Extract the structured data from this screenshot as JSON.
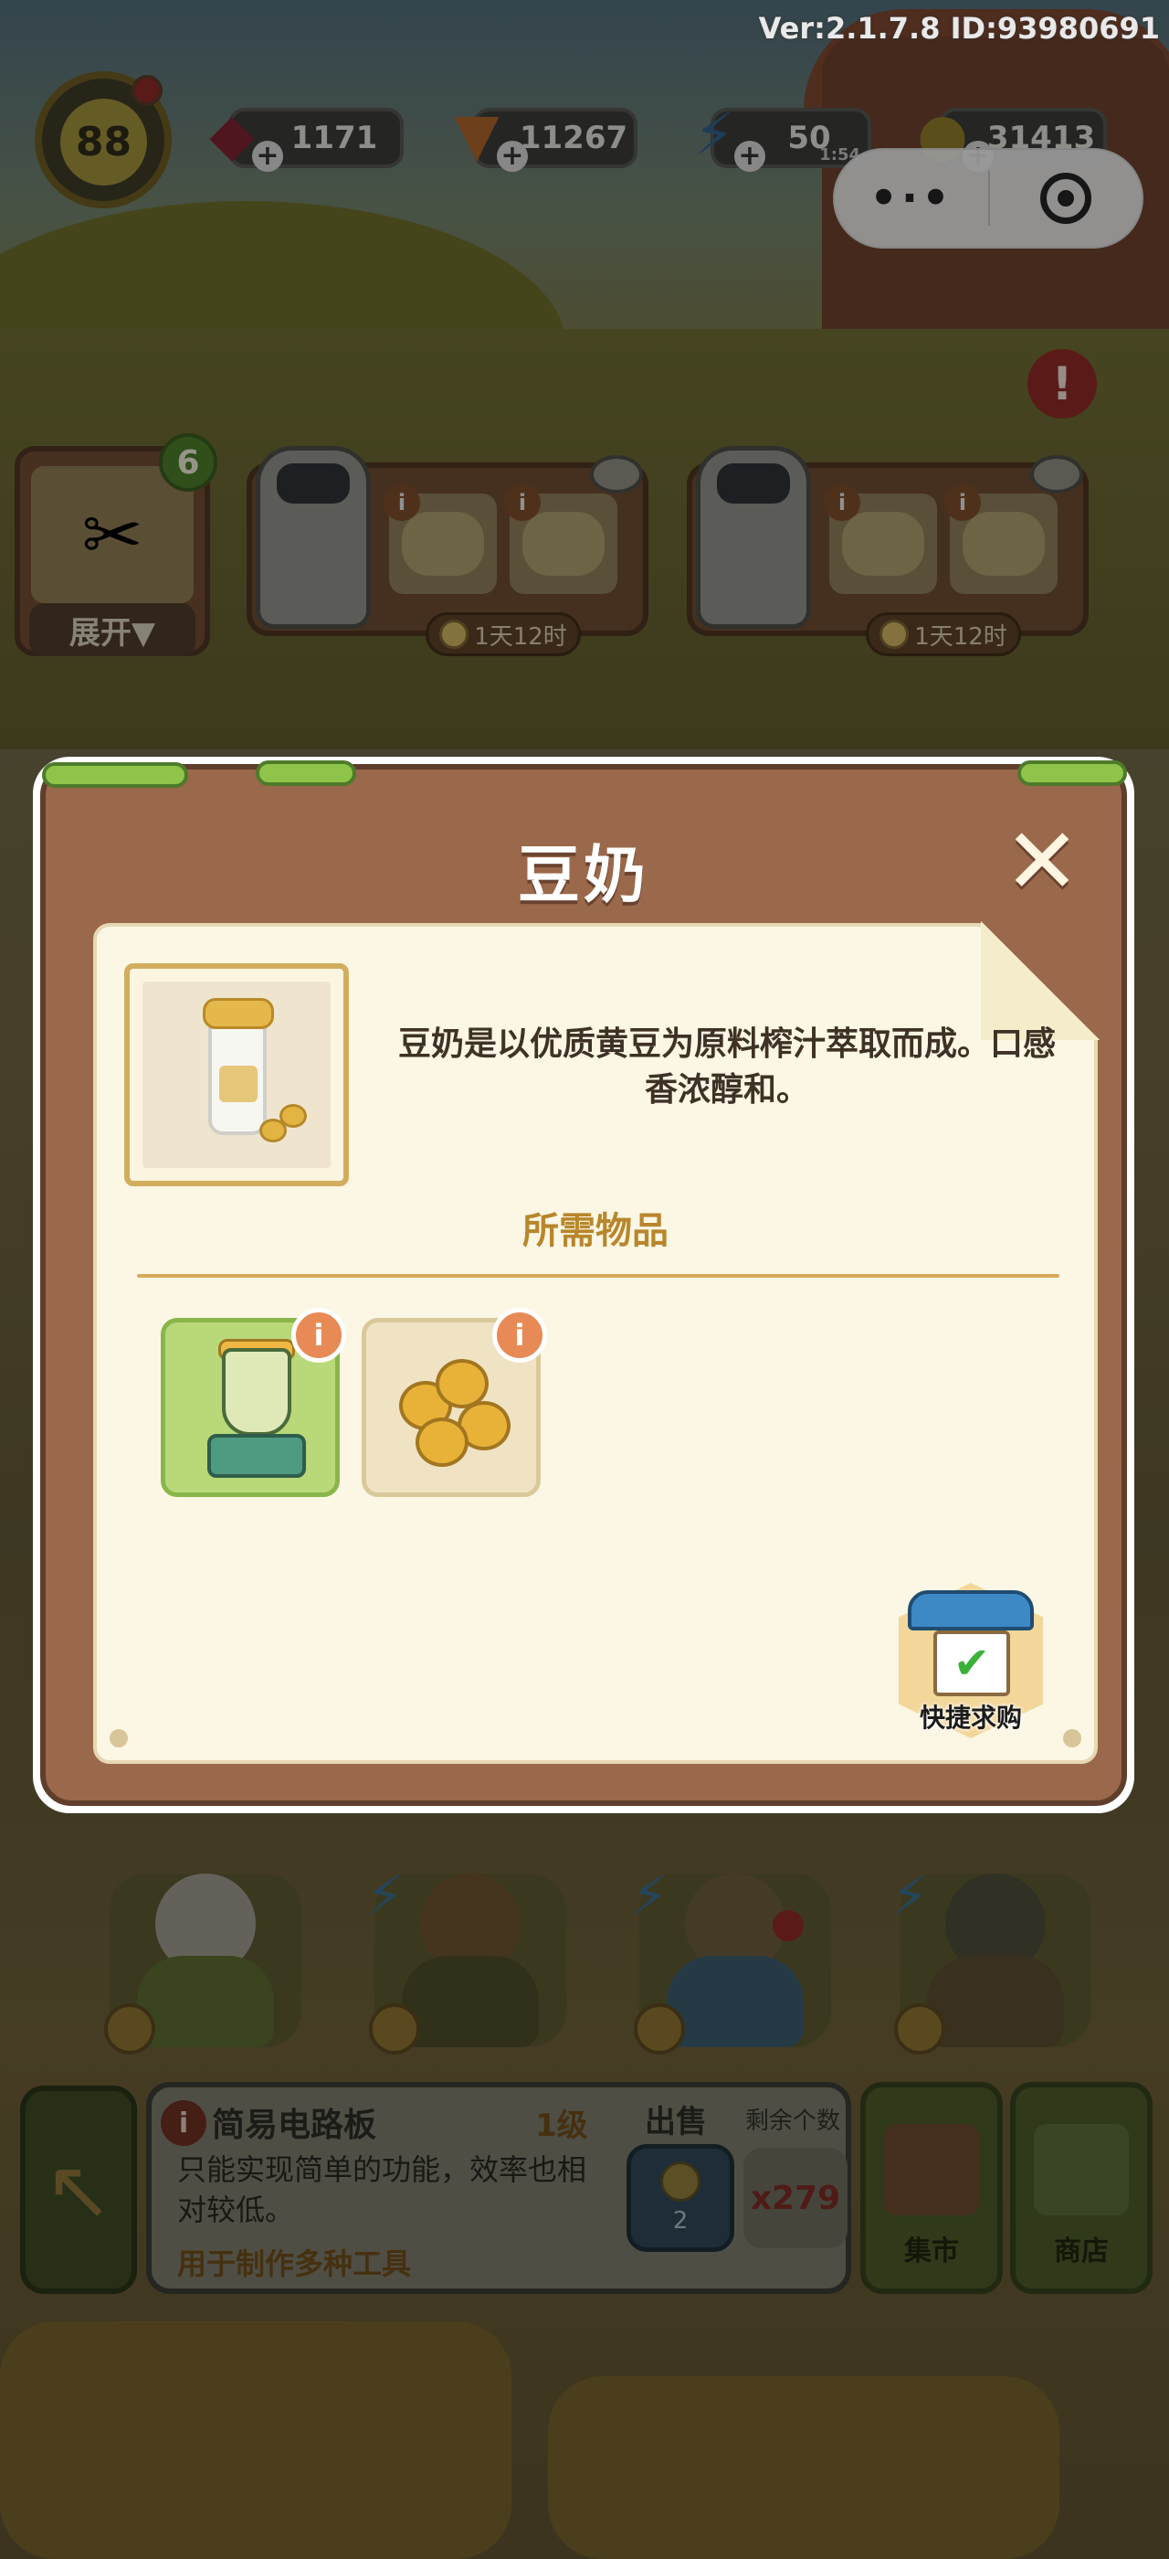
{
  "version_text": "Ver:2.1.7.8 ID:93980691",
  "player": {
    "level": "88"
  },
  "resources": [
    {
      "name": "gems",
      "icon": "gem-icon",
      "value": "1171"
    },
    {
      "name": "carrots",
      "icon": "carrot-icon",
      "value": "11267"
    },
    {
      "name": "energy",
      "icon": "lightning-icon",
      "value": "50",
      "sub": "1:54"
    },
    {
      "name": "coins",
      "icon": "coin-icon",
      "value": "31413"
    }
  ],
  "capsule": {
    "more_glyph": "•·•"
  },
  "production": {
    "expand_badge": "6",
    "expand_label": "展开▼",
    "machines": [
      {
        "timer": "1天12时"
      },
      {
        "timer": "1天12时"
      }
    ]
  },
  "modal": {
    "title": "豆奶",
    "close_glyph": "✕",
    "description": "豆奶是以优质黄豆为原料榨汁萃取而成。口感香浓醇和。",
    "required_title": "所需物品",
    "required_items": [
      {
        "icon": "juicer-icon",
        "info": "i",
        "bg": "#b8d879",
        "border": "#8ab649"
      },
      {
        "icon": "soybeans-icon",
        "info": "i",
        "bg": "#efe3c4",
        "border": "#d9c99a"
      }
    ],
    "quick_buy_label": "快捷求购",
    "quick_buy_check": "✔"
  },
  "bottom_item": {
    "info_glyph": "i",
    "name": "简易电路板",
    "level": "1级",
    "description": "只能实现简单的功能，效率也相对较低。",
    "usage": "用于制作多种工具",
    "sell_label": "出售",
    "sell_price": "2",
    "remaining_label": "剩余个数",
    "remaining_count": "x279"
  },
  "side_buttons": [
    {
      "label": "集市",
      "icon": "market-icon"
    },
    {
      "label": "商店",
      "icon": "shop-icon"
    }
  ],
  "colors": {
    "modal_frame": "#9a684a",
    "paper": "#fbf7e4",
    "accent_gold": "#b8862c",
    "info_orange": "#e88a55"
  }
}
